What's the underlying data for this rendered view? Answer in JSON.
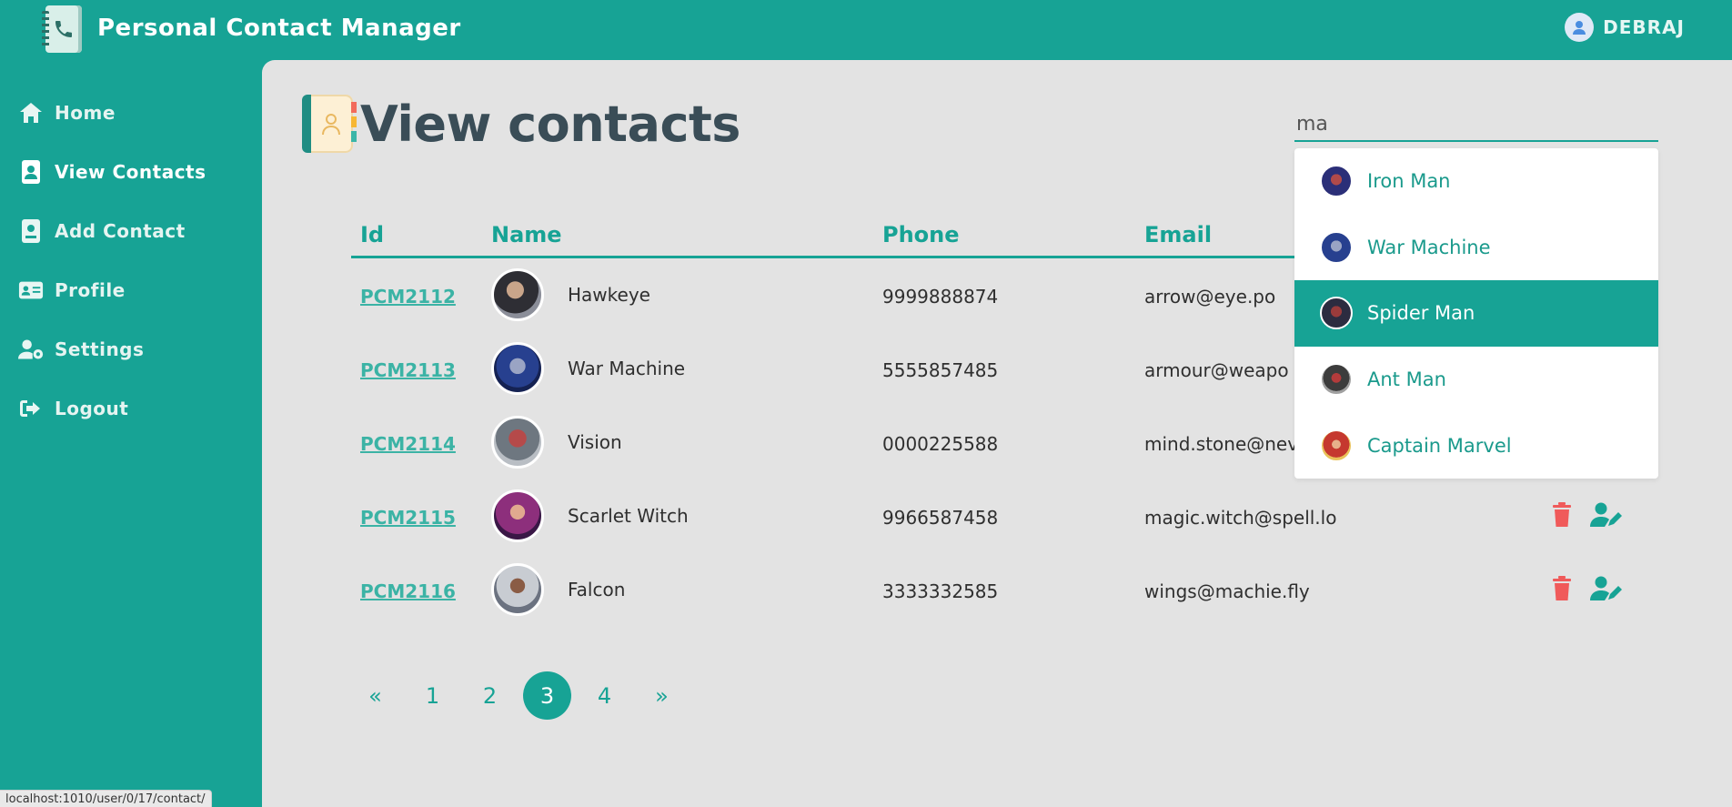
{
  "app": {
    "title": "Personal Contact Manager",
    "user_name": "DEBRAJ"
  },
  "sidebar": {
    "items": [
      {
        "label": "Home"
      },
      {
        "label": "View Contacts"
      },
      {
        "label": "Add Contact"
      },
      {
        "label": "Profile"
      },
      {
        "label": "Settings"
      },
      {
        "label": "Logout"
      }
    ]
  },
  "main": {
    "title": "View contacts",
    "search": {
      "value": "ma"
    },
    "suggestions": [
      {
        "name": "Iron Man",
        "active": false
      },
      {
        "name": "War Machine",
        "active": false
      },
      {
        "name": "Spider Man",
        "active": true
      },
      {
        "name": "Ant Man",
        "active": false
      },
      {
        "name": "Captain Marvel",
        "active": false
      }
    ],
    "table": {
      "headers": [
        "Id",
        "Name",
        "Phone",
        "Email"
      ],
      "rows": [
        {
          "id": "PCM2112",
          "name": "Hawkeye",
          "phone": "9999888874",
          "email": "arrow@eye.po"
        },
        {
          "id": "PCM2113",
          "name": "War Machine",
          "phone": "5555857485",
          "email": "armour@weapo"
        },
        {
          "id": "PCM2114",
          "name": "Vision",
          "phone": "0000225588",
          "email": "mind.stone@nev"
        },
        {
          "id": "PCM2115",
          "name": "Scarlet Witch",
          "phone": "9966587458",
          "email": "magic.witch@spell.lo"
        },
        {
          "id": "PCM2116",
          "name": "Falcon",
          "phone": "3333332585",
          "email": "wings@machie.fly"
        }
      ]
    },
    "pagination": {
      "prev": "«",
      "pages": [
        "1",
        "2",
        "3",
        "4"
      ],
      "current": "3",
      "next": "»"
    }
  },
  "statusbar": {
    "url": "localhost:1010/user/0/17/contact/"
  },
  "colors": {
    "accent": "#17a395",
    "background": "#e3e3e3",
    "delete": "#f05a5a",
    "title": "#3a4d57"
  },
  "icons": {
    "brand": "notebook-phone-icon",
    "user": "user-circle-icon",
    "sidebar": [
      "home-icon",
      "contact-book-icon",
      "add-contact-icon",
      "id-card-icon",
      "user-gear-icon",
      "logout-icon"
    ],
    "title": "address-book-icon",
    "row_actions": [
      "trash-icon",
      "user-edit-icon"
    ]
  }
}
